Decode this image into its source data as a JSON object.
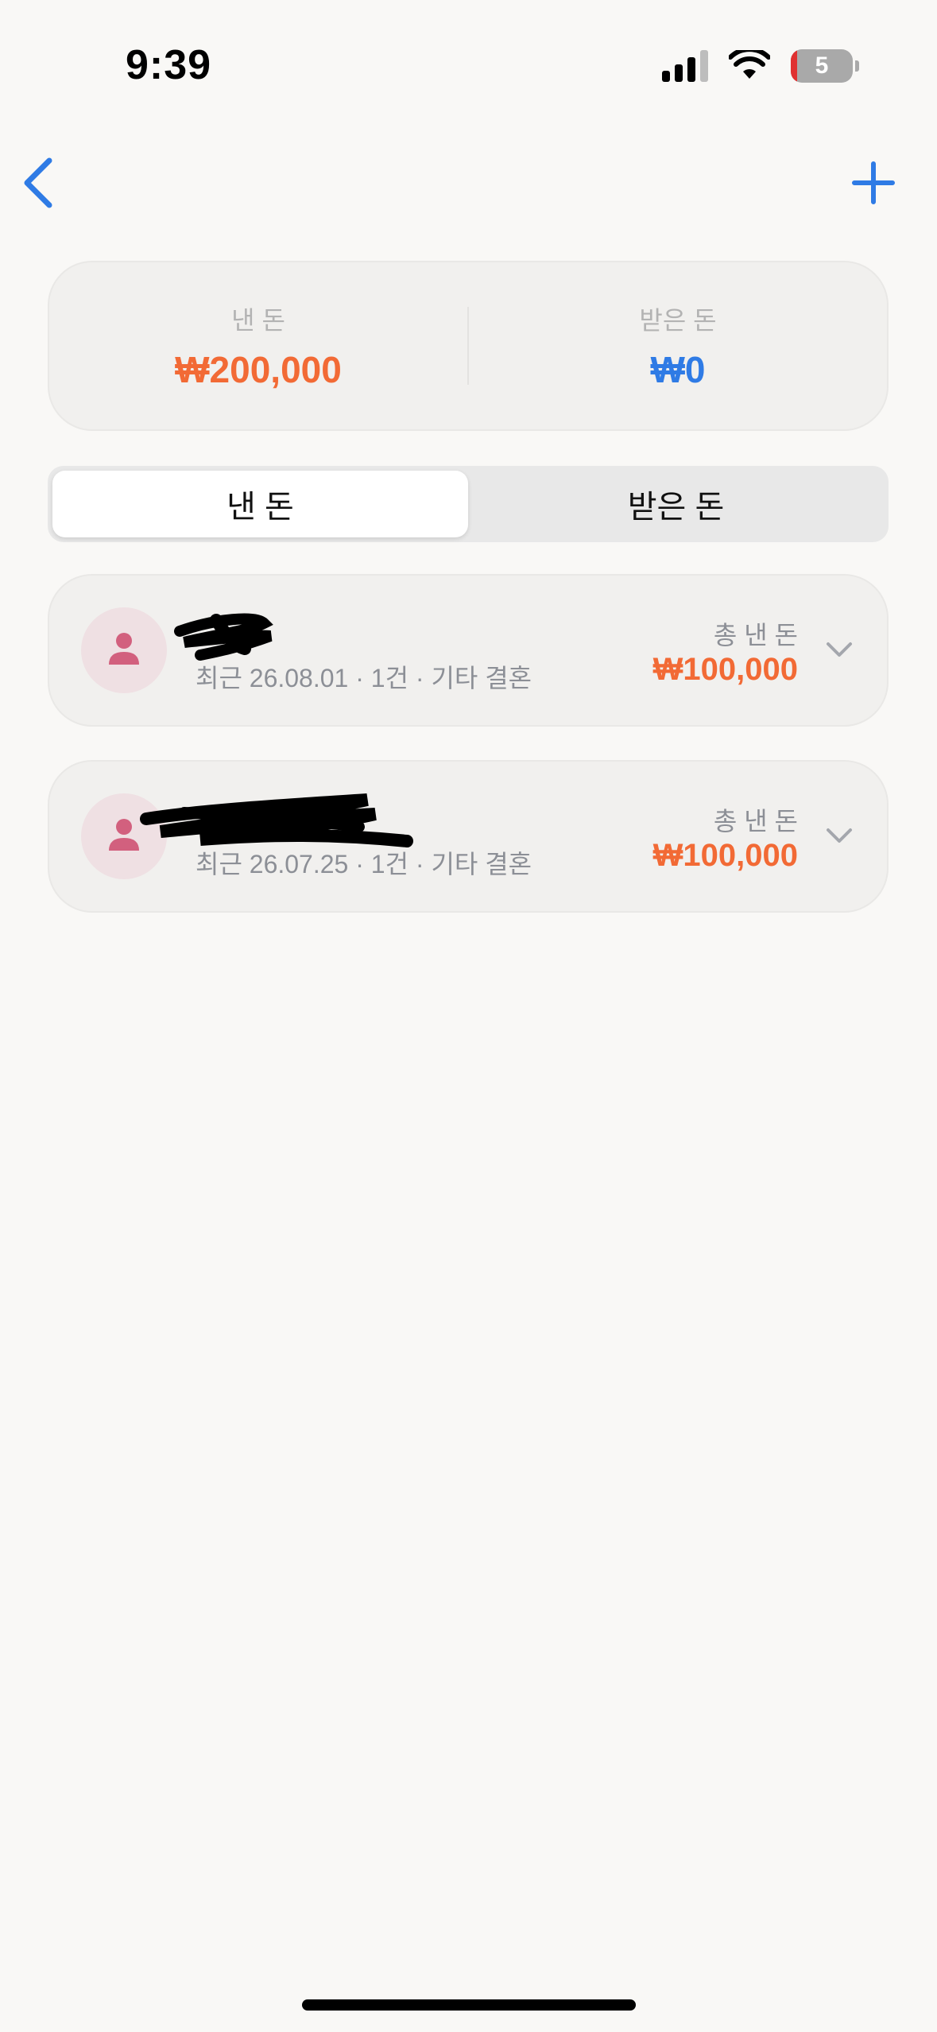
{
  "status_bar": {
    "time": "9:39",
    "battery_level": "5",
    "icons": [
      "signal-icon",
      "wifi-icon",
      "battery-icon"
    ]
  },
  "nav": {
    "back_icon": "chevron-left-icon",
    "add_icon": "plus-icon"
  },
  "summary": {
    "sent_label": "낸 돈",
    "sent_amount": "₩200,000",
    "received_label": "받은 돈",
    "received_amount": "₩0"
  },
  "tabs": [
    {
      "label": "낸 돈",
      "active": true
    },
    {
      "label": "받은 돈",
      "active": false
    }
  ],
  "people": [
    {
      "name": "",
      "meta": "최근 26.08.01 · 1건 · 기타 결혼",
      "total_label": "총 낸 돈",
      "total": "₩100,000"
    },
    {
      "name": "",
      "meta": "최근 26.07.25 · 1건 · 기타 결혼",
      "total_label": "총 낸 돈",
      "total": "₩100,000"
    }
  ],
  "colors": {
    "sent": "#f26a35",
    "received": "#2f7be5",
    "accent": "#2f7be5",
    "avatar_icon": "#d2607e"
  }
}
